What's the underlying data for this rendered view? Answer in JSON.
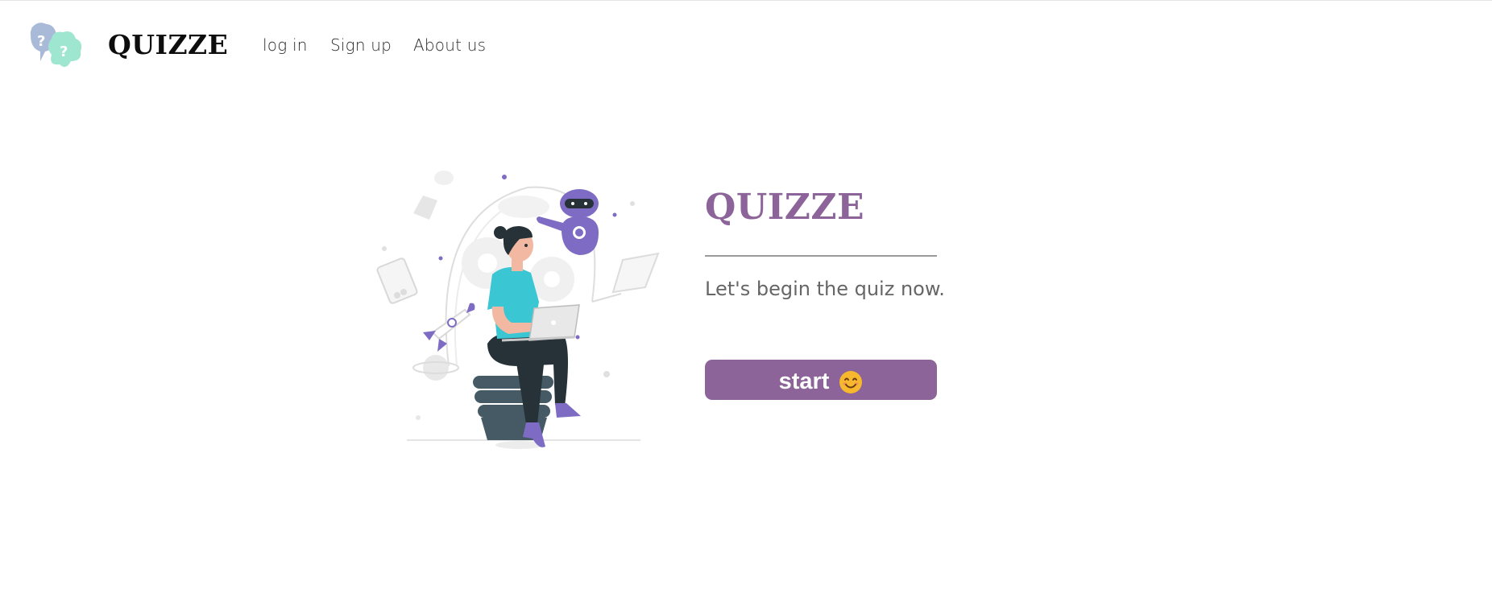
{
  "nav": {
    "brand": "QUIZZE",
    "links": [
      "log in",
      "Sign up",
      "About us"
    ]
  },
  "hero": {
    "title": "QUIZZE",
    "subtitle": "Let's begin the quiz now.",
    "start_label": "start"
  },
  "icons": {
    "logo": "question-bubbles-icon",
    "start": "smiling-face-icon",
    "illustration": "person-with-laptop-and-robot-illustration"
  },
  "colors": {
    "accent": "#8c6499",
    "logo_blue": "#a9b9d8",
    "logo_mint": "#9fe6d1",
    "shirt": "#3ac6d3",
    "robot": "#7e6cc4",
    "text_muted": "#666666"
  }
}
